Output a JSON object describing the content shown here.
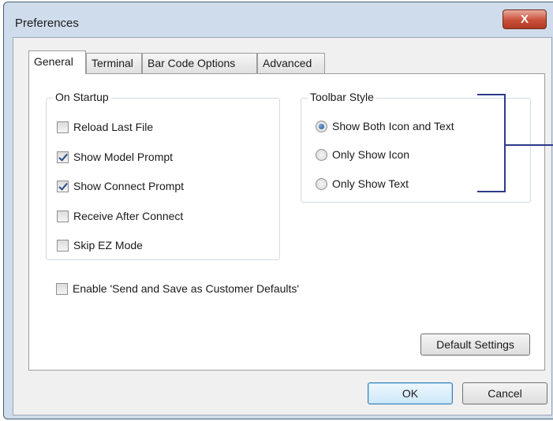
{
  "window": {
    "title": "Preferences",
    "close_label": "X"
  },
  "tabs": [
    {
      "label": "General",
      "active": true
    },
    {
      "label": "Terminal",
      "active": false
    },
    {
      "label": "Bar Code Options",
      "active": false
    },
    {
      "label": "Advanced",
      "active": false
    }
  ],
  "on_startup": {
    "title": "On Startup",
    "options": [
      {
        "label": "Reload Last File",
        "checked": false
      },
      {
        "label": "Show Model Prompt",
        "checked": true
      },
      {
        "label": "Show Connect Prompt",
        "checked": true
      },
      {
        "label": "Receive After Connect",
        "checked": false
      },
      {
        "label": "Skip EZ Mode",
        "checked": false
      }
    ]
  },
  "toolbar_style": {
    "title": "Toolbar Style",
    "options": [
      {
        "label": "Show Both Icon and Text",
        "selected": true
      },
      {
        "label": "Only Show Icon",
        "selected": false
      },
      {
        "label": "Only Show Text",
        "selected": false
      }
    ]
  },
  "enable_customer_defaults": {
    "label": "Enable 'Send and Save as Customer Defaults'",
    "checked": false
  },
  "buttons": {
    "default_settings": "Default Settings",
    "ok": "OK",
    "cancel": "Cancel"
  },
  "colors": {
    "window_frame": "#cfdceb",
    "close_button": "#c9503a",
    "annotation_bracket": "#2e3a8c"
  }
}
